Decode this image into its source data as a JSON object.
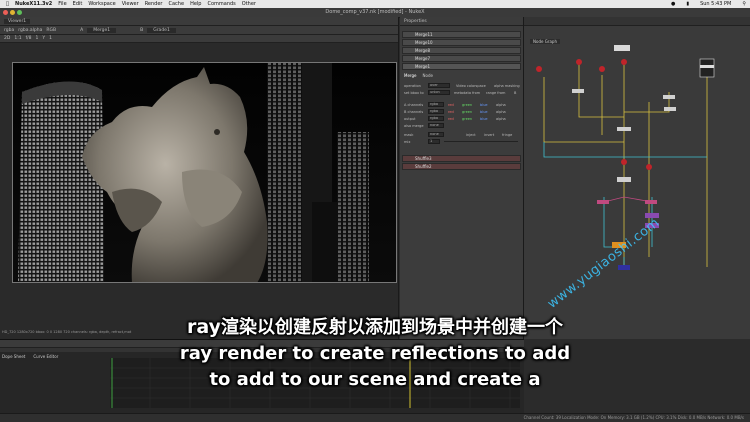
{
  "menubar": {
    "apple": "",
    "app_name": "NukeX11.3v2",
    "items": [
      "File",
      "Edit",
      "Workspace",
      "Viewer",
      "Render",
      "Cache",
      "Help",
      "Commands",
      "Other"
    ],
    "clock": "Sun 5:43 PM"
  },
  "window": {
    "title": "Dome_comp_v37.nk [modified] - NukeX"
  },
  "viewer": {
    "tab": "Viewer1",
    "toolbar1": [
      "rgba",
      "rgba.alpha",
      "RGB",
      "A",
      "Merge1",
      "B",
      "Grade1"
    ],
    "toolbar2": [
      "2D",
      "1:1",
      "f/8",
      "1",
      "Y",
      "1"
    ],
    "status_text": "HD_720 1280x720  bbox: 0 0 1280 720 channels: rgba, depth, refract,mot"
  },
  "properties": {
    "title": "Properties",
    "nodes": [
      "Merge11",
      "Merge10",
      "Merge8",
      "Merge7",
      "Merge1"
    ],
    "tabs": [
      "Merge",
      "Node"
    ],
    "labels": {
      "operation": "operation",
      "bbox": "set bbox to",
      "achannels": "A channels",
      "bchannels": "B channels",
      "output": "output",
      "also_merge": "also merge",
      "mask": "mask",
      "mix": "mix"
    },
    "values": {
      "operation": "over",
      "bbox": "union",
      "achannels": "rgba",
      "bchannels": "rgba",
      "output": "rgba",
      "also_merge": "none",
      "mask": "none",
      "mix": "1"
    },
    "checks": {
      "video_colorspace": "Video colorspace",
      "alpha_masking": "alpha masking",
      "metadata_from": "metadata from",
      "range_from": "range from",
      "B": "B"
    },
    "channel_checks": [
      "red",
      "green",
      "blue",
      "alpha"
    ],
    "mask_opts": [
      "inject",
      "invert",
      "fringe"
    ],
    "shuffle_nodes": [
      "Shuffle3",
      "Shuffle2"
    ]
  },
  "graph": {
    "tab": "Node Graph"
  },
  "dope": {
    "tabs": [
      "Dope Sheet",
      "Curve Editor"
    ]
  },
  "statusbar": {
    "text": "Channel Count: 39  Localization Mode: On  Memory: 3.1 GB (1.2%)  CPU: 3.1%  Disk: 0.0 MB/s  Network: 0.0 MB/s"
  },
  "subtitles": {
    "line1_latin": "ray",
    "line1_cjk": "渲染以创建反射以添加到场景中并创建一个",
    "line2": "ray render to create reflections to add",
    "line3": "to add to our scene and create a"
  },
  "watermark": "www.yugiaoshi.com",
  "colors": {
    "accent": "#f0a030",
    "node_red": "#c0242a",
    "edge_yellow": "#d8c040",
    "edge_cyan": "#40c0d0"
  }
}
